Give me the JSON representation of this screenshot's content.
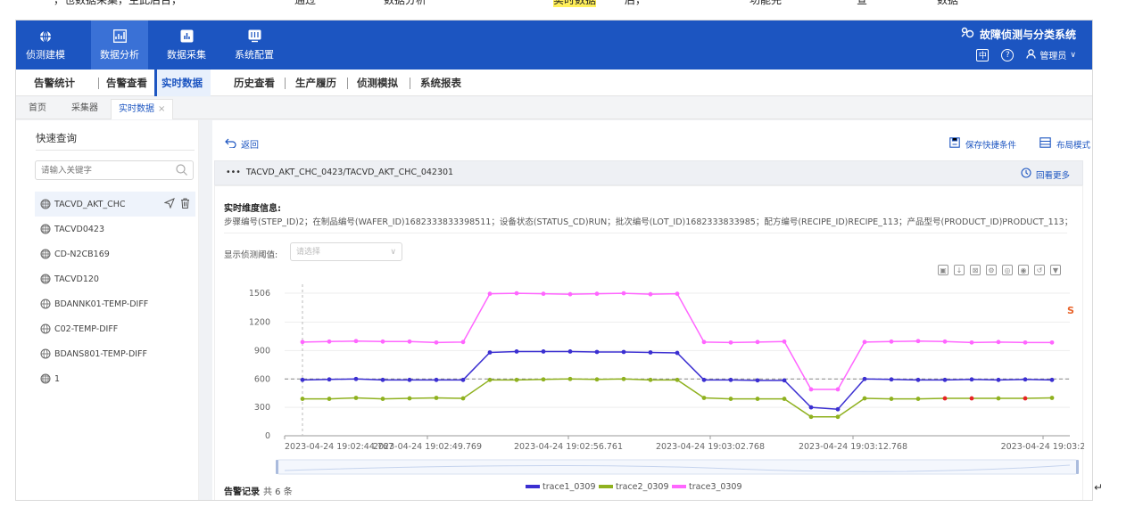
{
  "strip": {
    "t1": "，也数据采集，生此后台，",
    "t2": "通过",
    "t3": "数据分析",
    "t4": "实时数据",
    "t5": "后，",
    "t6": "功能完",
    "t7": "查",
    "t8": "数据"
  },
  "topbar": {
    "system_name": "故障侦测与分类系统",
    "nav": [
      {
        "label": "侦测建模",
        "icon": "globe-icon"
      },
      {
        "label": "数据分析",
        "icon": "chart-icon"
      },
      {
        "label": "数据采集",
        "icon": "bar-chart-icon"
      },
      {
        "label": "系统配置",
        "icon": "settings-icon"
      }
    ],
    "lang": "中",
    "help": "?",
    "user": "管理员"
  },
  "subnav": [
    "告警统计",
    "告警查看",
    "实时数据",
    "历史查看",
    "生产履历",
    "侦测模拟",
    "系统报表"
  ],
  "tabs": [
    {
      "label": "首页"
    },
    {
      "label": "采集器"
    },
    {
      "label": "实时数据",
      "close": "×"
    }
  ],
  "sidebar": {
    "title": "快速查询",
    "search_placeholder": "请输入关键字",
    "items": [
      {
        "label": "TACVD_AKT_CHC",
        "icon": "multi-icon"
      },
      {
        "label": "TACVD0423",
        "icon": "multi-icon"
      },
      {
        "label": "CD-N2CB169",
        "icon": "multi-icon"
      },
      {
        "label": "TACVD120",
        "icon": "multi-icon"
      },
      {
        "label": "BDANNK01-TEMP-DIFF",
        "icon": "globe-icon"
      },
      {
        "label": "C02-TEMP-DIFF",
        "icon": "globe-icon"
      },
      {
        "label": "BDANS801-TEMP-DIFF",
        "icon": "globe-icon"
      },
      {
        "label": "1",
        "icon": "multi-icon"
      }
    ]
  },
  "main": {
    "back": "返回",
    "save_condition": "保存快捷条件",
    "layout_mode": "布局模式",
    "path": "TACVD_AKT_CHC_0423/TACVD_AKT_CHC_042301",
    "path_prefix": "•••",
    "view_more": "回看更多",
    "info_title": "实时维度信息:",
    "info_detail": "步骤编号(STEP_ID)2；在制品编号(WAFER_ID)1682333833398511；设备状态(STATUS_CD)RUN；批次编号(LOT_ID)1682333833985；配方编号(RECIPE_ID)RECIPE_113；产品型号(PRODUCT_ID)PRODUCT_113；",
    "threshold_label": "显示侦测阈值:",
    "threshold_placeholder": "请选择",
    "alarm_title": "告警记录",
    "alarm_count": "共 6 条"
  },
  "chart_data": {
    "type": "line",
    "yticks": [
      0,
      300,
      600,
      900,
      1200,
      1506
    ],
    "ylim": [
      0,
      1506
    ],
    "xtick_labels": [
      "2023-04-24 19:02:44.767",
      "2023-04-24 19:02:49.769",
      "2023-04-24 19:02:56.761",
      "2023-04-24 19:03:02.768",
      "2023-04-24 19:03:12.768",
      "2023-04-24 19:03:2"
    ],
    "reference_line": 600,
    "series": [
      {
        "name": "trace1_0309",
        "color": "#3b2fd1",
        "values": [
          590,
          595,
          600,
          590,
          590,
          590,
          590,
          880,
          890,
          890,
          890,
          885,
          885,
          880,
          875,
          590,
          590,
          585,
          585,
          300,
          280,
          600,
          595,
          590,
          590,
          595,
          590,
          595,
          590
        ]
      },
      {
        "name": "trace2_0309",
        "color": "#8fb11f",
        "values": [
          390,
          390,
          400,
          390,
          395,
          400,
          395,
          590,
          590,
          595,
          600,
          595,
          600,
          590,
          590,
          400,
          390,
          390,
          390,
          200,
          200,
          395,
          390,
          390,
          395,
          395,
          395,
          395,
          400
        ]
      },
      {
        "name": "trace3_0309",
        "color": "#ff66ff",
        "values": [
          990,
          995,
          1000,
          995,
          995,
          985,
          990,
          1500,
          1505,
          1500,
          1495,
          1500,
          1505,
          1495,
          1500,
          990,
          985,
          990,
          995,
          490,
          490,
          990,
          995,
          1000,
          995,
          985,
          990,
          985,
          985
        ]
      }
    ],
    "red_points": [
      {
        "series": "trace2_0309",
        "index": 24
      },
      {
        "series": "trace2_0309",
        "index": 25
      },
      {
        "series": "trace2_0309",
        "index": 27
      }
    ]
  },
  "colors": {
    "brand": "#1c55c1",
    "active_nav": "#3a71d6",
    "alarm_point": "#e62424"
  }
}
